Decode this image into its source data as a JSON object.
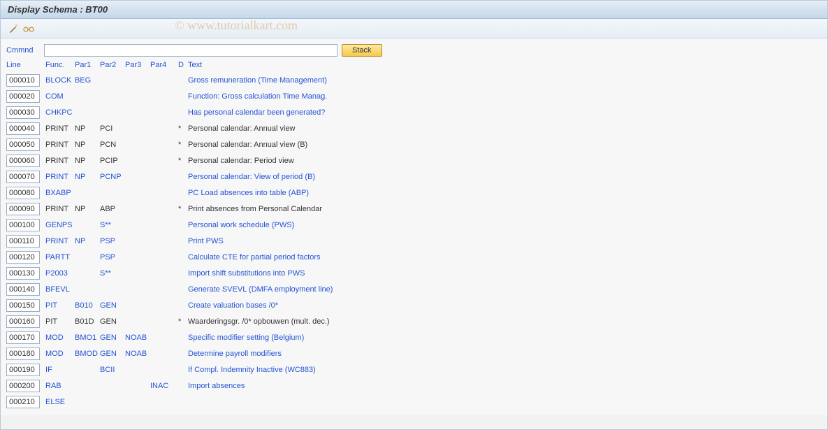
{
  "title": "Display Schema : BT00",
  "watermark": "© www.tutorialkart.com",
  "toolbar": {
    "icon1_name": "wand-icon",
    "icon2_name": "glasses-icon"
  },
  "cmd": {
    "label": "Cmmnd",
    "value": "",
    "stack_label": "Stack"
  },
  "headers": {
    "line": "Line",
    "func": "Func.",
    "par1": "Par1",
    "par2": "Par2",
    "par3": "Par3",
    "par4": "Par4",
    "d": "D",
    "text": "Text"
  },
  "rows": [
    {
      "line": "000010",
      "func": "BLOCK",
      "par1": "BEG",
      "par2": "",
      "par3": "",
      "par4": "",
      "d": "",
      "text": "Gross remuneration (Time Management)",
      "link": true
    },
    {
      "line": "000020",
      "func": "COM",
      "par1": "",
      "par2": "",
      "par3": "",
      "par4": "",
      "d": "",
      "text": "Function: Gross calculation Time Manag.",
      "link": true
    },
    {
      "line": "000030",
      "func": "CHKPC",
      "par1": "",
      "par2": "",
      "par3": "",
      "par4": "",
      "d": "",
      "text": "Has personal calendar been generated?",
      "link": true
    },
    {
      "line": "000040",
      "func": "PRINT",
      "par1": "NP",
      "par2": "PCI",
      "par3": "",
      "par4": "",
      "d": "*",
      "text": "Personal calendar: Annual view",
      "link": false
    },
    {
      "line": "000050",
      "func": "PRINT",
      "par1": "NP",
      "par2": "PCN",
      "par3": "",
      "par4": "",
      "d": "*",
      "text": "Personal calendar: Annual view (B)",
      "link": false
    },
    {
      "line": "000060",
      "func": "PRINT",
      "par1": "NP",
      "par2": "PCIP",
      "par3": "",
      "par4": "",
      "d": "*",
      "text": "Personal calendar: Period view",
      "link": false
    },
    {
      "line": "000070",
      "func": "PRINT",
      "par1": "NP",
      "par2": "PCNP",
      "par3": "",
      "par4": "",
      "d": "",
      "text": "Personal calendar: View of period (B)",
      "link": true
    },
    {
      "line": "000080",
      "func": "BXABP",
      "par1": "",
      "par2": "",
      "par3": "",
      "par4": "",
      "d": "",
      "text": "PC Load absences into table (ABP)",
      "link": true
    },
    {
      "line": "000090",
      "func": "PRINT",
      "par1": "NP",
      "par2": "ABP",
      "par3": "",
      "par4": "",
      "d": "*",
      "text": "Print absences from Personal Calendar",
      "link": false
    },
    {
      "line": "000100",
      "func": "GENPS",
      "par1": "",
      "par2": "S**",
      "par3": "",
      "par4": "",
      "d": "",
      "text": "Personal work schedule (PWS)",
      "link": true
    },
    {
      "line": "000110",
      "func": "PRINT",
      "par1": "NP",
      "par2": "PSP",
      "par3": "",
      "par4": "",
      "d": "",
      "text": "Print PWS",
      "link": true
    },
    {
      "line": "000120",
      "func": "PARTT",
      "par1": "",
      "par2": "PSP",
      "par3": "",
      "par4": "",
      "d": "",
      "text": "Calculate CTE for partial period factors",
      "link": true
    },
    {
      "line": "000130",
      "func": "P2003",
      "par1": "",
      "par2": "S**",
      "par3": "",
      "par4": "",
      "d": "",
      "text": "Import shift substitutions into PWS",
      "link": true
    },
    {
      "line": "000140",
      "func": "BFEVL",
      "par1": "",
      "par2": "",
      "par3": "",
      "par4": "",
      "d": "",
      "text": "Generate SVEVL (DMFA employment line)",
      "link": true
    },
    {
      "line": "000150",
      "func": "PIT",
      "par1": "B010",
      "par2": "GEN",
      "par3": "",
      "par4": "",
      "d": "",
      "text": "Create valuation bases /0*",
      "link": true
    },
    {
      "line": "000160",
      "func": "PIT",
      "par1": "B01D",
      "par2": "GEN",
      "par3": "",
      "par4": "",
      "d": "*",
      "text": "Waarderingsgr. /0* opbouwen (mult. dec.)",
      "link": false
    },
    {
      "line": "000170",
      "func": "MOD",
      "par1": "BMO1",
      "par2": "GEN",
      "par3": "NOAB",
      "par4": "",
      "d": "",
      "text": "Specific modifier setting (Belgium)",
      "link": true
    },
    {
      "line": "000180",
      "func": "MOD",
      "par1": "BMOD",
      "par2": "GEN",
      "par3": "NOAB",
      "par4": "",
      "d": "",
      "text": "Determine payroll modifiers",
      "link": true
    },
    {
      "line": "000190",
      "func": "IF",
      "par1": "",
      "par2": "BCII",
      "par3": "",
      "par4": "",
      "d": "",
      "text": "If Compl. Indemnity Inactive (WC883)",
      "link": true
    },
    {
      "line": "000200",
      "func": "RAB",
      "par1": "",
      "par2": "",
      "par3": "",
      "par4": "INAC",
      "d": "",
      "text": "Import absences",
      "link": true
    },
    {
      "line": "000210",
      "func": "ELSE",
      "par1": "",
      "par2": "",
      "par3": "",
      "par4": "",
      "d": "",
      "text": "",
      "link": true
    }
  ]
}
